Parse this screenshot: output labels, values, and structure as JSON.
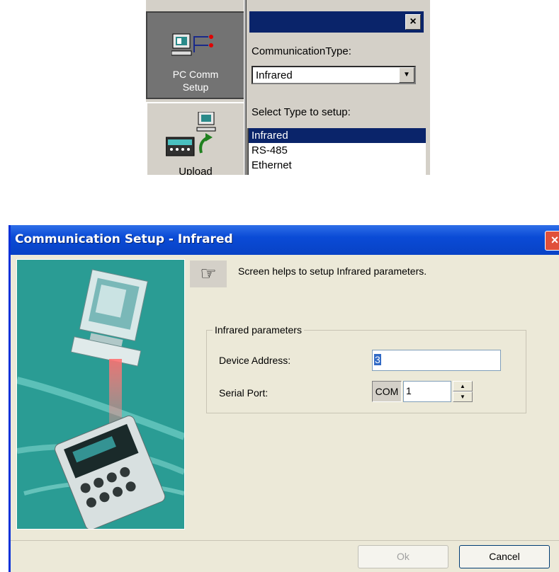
{
  "top_panel": {
    "nav": {
      "pc_comm_label_1": "PC Comm",
      "pc_comm_label_2": "Setup",
      "upload_label": "Upload"
    },
    "close_glyph": "×",
    "communication_type_label": "CommunicationType:",
    "communication_type_value": "Infrared",
    "select_type_label": "Select Type to setup:",
    "types": [
      "Infrared",
      "RS-485",
      "Ethernet"
    ],
    "selected_type": "Infrared"
  },
  "dialog": {
    "title": "Communication Setup - Infrared",
    "close_glyph": "×",
    "hint_text": "Screen helps to setup Infrared parameters.",
    "group_label": "Infrared parameters",
    "device_address_label": "Device Address:",
    "device_address_value": "3",
    "serial_port_label": "Serial Port:",
    "com_label": "COM",
    "serial_port_value": "1",
    "ok_label": "Ok",
    "cancel_label": "Cancel"
  },
  "colors": {
    "titlebar": "#0a4bd6",
    "selection": "#0a246a",
    "dialog_bg": "#ece9d8",
    "illustration_bg": "#2a9c94"
  },
  "icons": [
    "pc-network-icon",
    "upload-device-icon",
    "pointing-hand-icon",
    "close-icon",
    "dropdown-arrow-icon",
    "spin-up-icon",
    "spin-down-icon"
  ]
}
